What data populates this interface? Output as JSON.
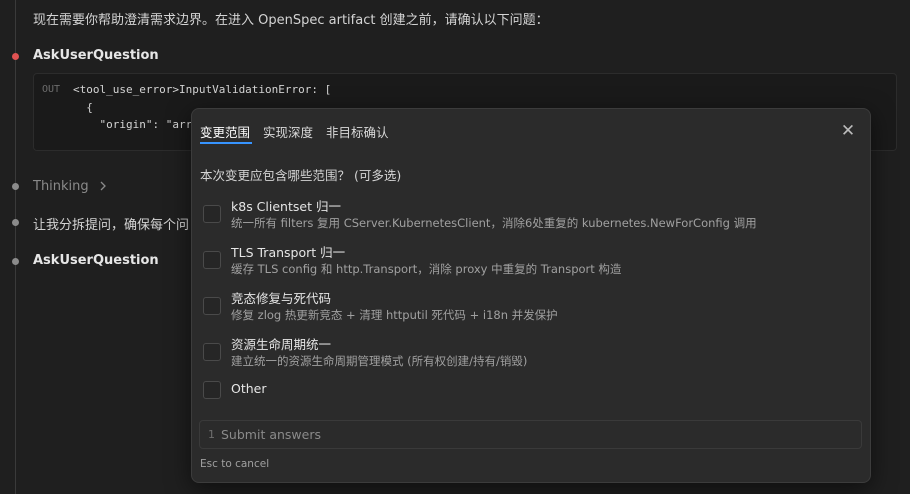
{
  "chat": {
    "intro": "现在需要你帮助澄清需求边界。在进入 OpenSpec artifact 创建之前，请确认以下问题：",
    "tool_call_1": "AskUserQuestion",
    "output": {
      "label": "OUT",
      "lines": [
        "<tool_use_error>InputValidationError: [",
        "  {",
        "    \"origin\": \"array"
      ]
    },
    "thinking": "Thinking",
    "thinking_icon": "chevron-right-icon",
    "message": "让我分拆提问，确保每个问",
    "tool_call_2": "AskUserQuestion"
  },
  "dialog": {
    "tabs": [
      "变更范围",
      "实现深度",
      "非目标确认"
    ],
    "active_tab": 0,
    "close_icon": "close-icon",
    "question": "本次变更应包含哪些范围？ (可多选)",
    "options": [
      {
        "title": "k8s Clientset 归一",
        "description": "统一所有 filters 复用 CServer.KubernetesClient，消除6处重复的 kubernetes.NewForConfig 调用"
      },
      {
        "title": "TLS Transport 归一",
        "description": "缓存 TLS config 和 http.Transport，消除 proxy 中重复的 Transport 构造"
      },
      {
        "title": "竞态修复与死代码",
        "description": "修复 zlog 热更新竞态 + 清理 httputil 死代码 + i18n 并发保护"
      },
      {
        "title": "资源生命周期统一",
        "description": "建立统一的资源生命周期管理模式 (所有权创建/持有/销毁)"
      },
      {
        "title": "Other",
        "description": ""
      }
    ],
    "submit": {
      "number": "1",
      "label": "Submit answers"
    },
    "hint": "Esc to cancel"
  },
  "colors": {
    "background": "#1f1f1f",
    "dialog": "#2b2b2b",
    "accent": "#3794ff",
    "error_dot": "#e05252"
  }
}
